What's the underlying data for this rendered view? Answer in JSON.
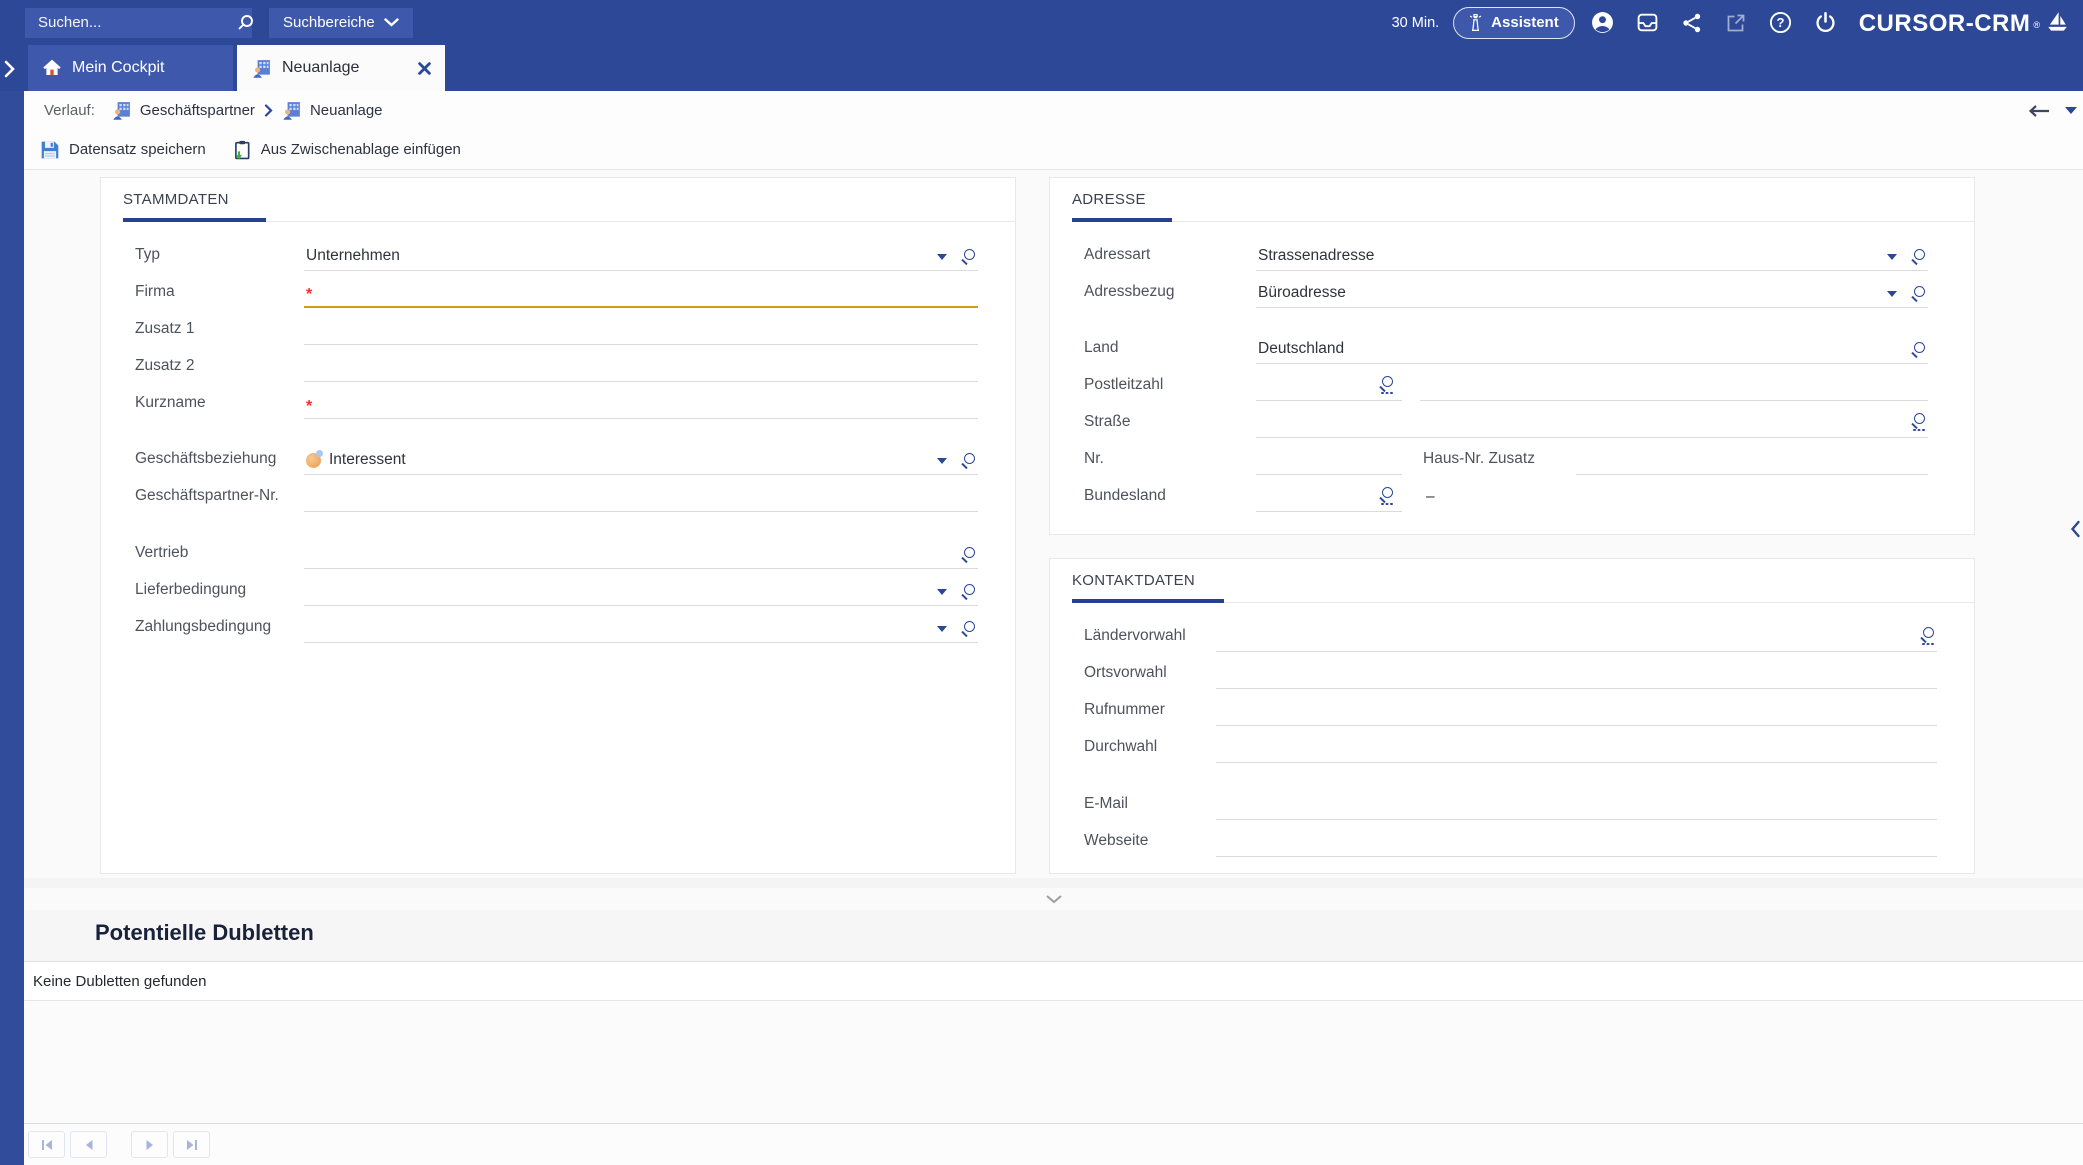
{
  "topbar": {
    "search": {
      "placeholder": "Suchen..."
    },
    "scope_button": "Suchbereiche",
    "session": "30 Min.",
    "assistant": "Assistent",
    "brand": "CURSOR-CRM",
    "brand_mark": "®"
  },
  "tabs": {
    "cockpit": "Mein Cockpit",
    "neuanlage": "Neuanlage"
  },
  "breadcrumb": {
    "prefix": "Verlauf:",
    "item1": "Geschäftspartner",
    "item2": "Neuanlage"
  },
  "toolbar": {
    "save": "Datensatz speichern",
    "paste": "Aus Zwischenablage einfügen"
  },
  "required_mark": "*",
  "stammdaten": {
    "title": "STAMMDATEN",
    "typ": {
      "label": "Typ",
      "value": "Unternehmen"
    },
    "firma": {
      "label": "Firma"
    },
    "zusatz1": {
      "label": "Zusatz 1"
    },
    "zusatz2": {
      "label": "Zusatz 2"
    },
    "kurzname": {
      "label": "Kurzname"
    },
    "geschaeftsbeziehung": {
      "label": "Geschäftsbeziehung",
      "value": "Interessent"
    },
    "geschaeftspartner_nr": {
      "label": "Geschäftspartner-Nr."
    },
    "vertrieb": {
      "label": "Vertrieb"
    },
    "lieferbedingung": {
      "label": "Lieferbedingung"
    },
    "zahlungsbedingung": {
      "label": "Zahlungsbedingung"
    }
  },
  "adresse": {
    "title": "ADRESSE",
    "adressart": {
      "label": "Adressart",
      "value": "Strassenadresse"
    },
    "adressbezug": {
      "label": "Adressbezug",
      "value": "Büroadresse"
    },
    "land": {
      "label": "Land",
      "value": "Deutschland"
    },
    "postleitzahl": {
      "label": "Postleitzahl"
    },
    "strasse": {
      "label": "Straße"
    },
    "nr": {
      "label": "Nr."
    },
    "hausnr_zusatz": {
      "label": "Haus-Nr. Zusatz"
    },
    "bundesland": {
      "label": "Bundesland",
      "dash": "–"
    }
  },
  "kontaktdaten": {
    "title": "KONTAKTDATEN",
    "laendervorwahl": {
      "label": "Ländervorwahl"
    },
    "ortsvorwahl": {
      "label": "Ortsvorwahl"
    },
    "rufnummer": {
      "label": "Rufnummer"
    },
    "durchwahl": {
      "label": "Durchwahl"
    },
    "email": {
      "label": "E-Mail"
    },
    "webseite": {
      "label": "Webseite"
    }
  },
  "dubletten": {
    "title": "Potentielle Dubletten",
    "empty": "Keine Dubletten gefunden"
  },
  "colors": {
    "c-topbar": "#2d4897",
    "c-chip": "#3e59ab",
    "c-accent": "#2c4797",
    "c-strip": "#314c9b",
    "c-focus": "#d0a011",
    "c-required": "#e5342a",
    "c-navy": "#1a2239"
  }
}
